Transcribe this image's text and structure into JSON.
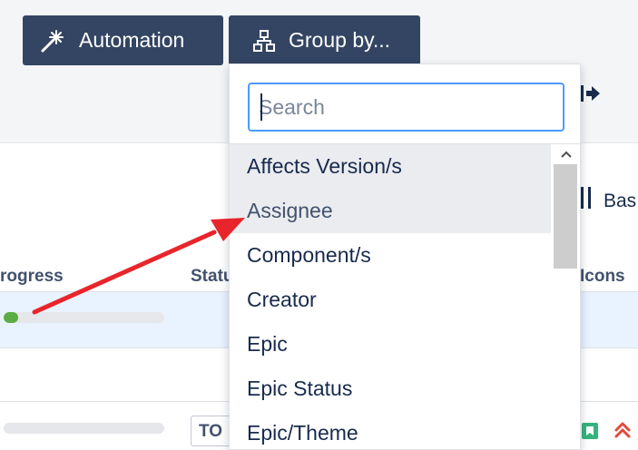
{
  "toolbar": {
    "automation_label": "Automation",
    "groupby_label": "Group by..."
  },
  "table": {
    "headers": {
      "progress": "rogress",
      "status": "Statu",
      "icons": "Icons"
    },
    "side_text": "Bas",
    "rows": [
      {
        "progress": 0.09
      },
      {
        "progress": 0,
        "status": "TO"
      }
    ]
  },
  "dropdown": {
    "search_placeholder": "Search",
    "options": [
      "Affects Version/s",
      "Assignee",
      "Component/s",
      "Creator",
      "Epic",
      "Epic Status",
      "Epic/Theme"
    ],
    "highlighted_index": 1
  },
  "colors": {
    "toolbar_button": "#344563",
    "row_highlight": "#e9f2ff",
    "search_focus": "#4c9aff",
    "progress_fill": "#5aac44",
    "annotation_arrow": "#e8252a",
    "story_icon": "#36b37e",
    "priority_icon": "#e5493a"
  },
  "icons": {
    "automation": "magic-wand-icon",
    "group_by": "hierarchy-icon",
    "exit": "exit-arrow-icon",
    "board_view": "columns-icon",
    "story": "story-bookmark-icon",
    "priority": "priority-highest-icon",
    "scroll_up": "chevron-up-icon"
  }
}
